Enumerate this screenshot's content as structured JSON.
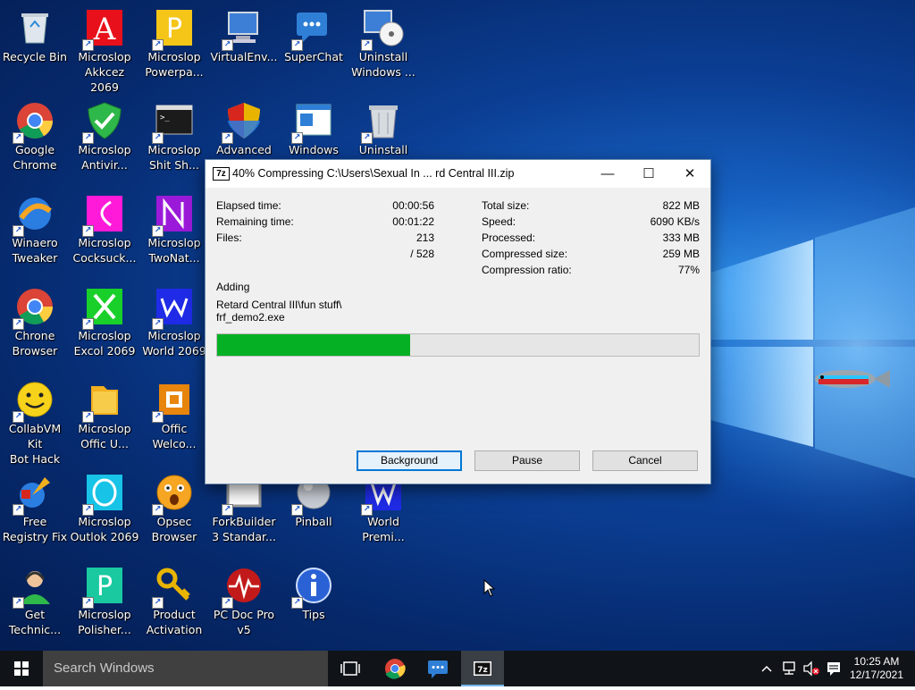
{
  "desktop": {
    "icons": [
      {
        "label": "Recycle Bin",
        "icon": "recycle-bin-icon"
      },
      {
        "label": "Microslop\nAkkcez 2069",
        "icon": "access-app-icon"
      },
      {
        "label": "Microslop\nPowerpa...",
        "icon": "powerpoint-app-icon"
      },
      {
        "label": "VirtualEnv...",
        "icon": "computer-icon"
      },
      {
        "label": "SuperChat",
        "icon": "chat-icon"
      },
      {
        "label": "Uninstall\nWindows ...",
        "icon": "disc-icon"
      },
      {
        "label": "Google\nChrome",
        "icon": "chrome-icon"
      },
      {
        "label": "Microslop\nAntivir...",
        "icon": "shield-check-icon"
      },
      {
        "label": "Microslop\nShit Sh...",
        "icon": "terminal-icon"
      },
      {
        "label": "Advanced",
        "icon": "security-shield-icon"
      },
      {
        "label": "Windows",
        "icon": "window-icon"
      },
      {
        "label": "Uninstall",
        "icon": "trash-can-icon"
      },
      {
        "label": "Winaero\nTweaker",
        "icon": "winaero-icon"
      },
      {
        "label": "Microslop\nCocksuck...",
        "icon": "app-magenta-icon"
      },
      {
        "label": "Microslop\nTwoNat...",
        "icon": "app-purple-icon"
      },
      {
        "label": "Chrone\nBrowser",
        "icon": "chrome-icon"
      },
      {
        "label": "Microslop\nExcol 2069",
        "icon": "excel-app-icon"
      },
      {
        "label": "Microslop\nWorld 2069",
        "icon": "word-app-icon"
      },
      {
        "label": "CollabVM Kit\nBot Hack",
        "icon": "smiley-icon"
      },
      {
        "label": "Microslop\nOffic U...",
        "icon": "office-folder-icon"
      },
      {
        "label": "Offic\nWelco...",
        "icon": "office-logo-icon"
      },
      {
        "label": "Free\nRegistry Fix",
        "icon": "registry-fix-icon"
      },
      {
        "label": "Microslop\nOutlok 2069",
        "icon": "outlook-app-icon"
      },
      {
        "label": "Opsec\nBrowser",
        "icon": "shocked-face-icon"
      },
      {
        "label": "ForkBuilder\n3 Standar...",
        "icon": "forkbuilder-icon"
      },
      {
        "label": "Pinball",
        "icon": "pinball-icon"
      },
      {
        "label": "World\nPremi...",
        "icon": "word-premium-icon"
      },
      {
        "label": "Get\nTechnic...",
        "icon": "support-person-icon"
      },
      {
        "label": "Microslop\nPolisher...",
        "icon": "publisher-app-icon"
      },
      {
        "label": "Product\nActivation",
        "icon": "key-icon"
      },
      {
        "label": "PC Doc Pro\nv5",
        "icon": "pc-doc-icon"
      },
      {
        "label": "Tips",
        "icon": "info-icon"
      }
    ]
  },
  "dialog": {
    "app_icon": "7z",
    "title": "40% Compressing C:\\Users\\Sexual In ... rd Central III.zip",
    "controls": {
      "minimize": "—",
      "maximize": "☐",
      "close": "✕"
    },
    "left_stats": [
      {
        "label": "Elapsed time:",
        "value": "00:00:56"
      },
      {
        "label": "Remaining time:",
        "value": "00:01:22"
      },
      {
        "label": "Files:",
        "value": "213"
      },
      {
        "label": "",
        "value": "/ 528"
      }
    ],
    "right_stats": [
      {
        "label": "Total size:",
        "value": "822 MB"
      },
      {
        "label": "Speed:",
        "value": "6090 KB/s"
      },
      {
        "label": "Processed:",
        "value": "333 MB"
      },
      {
        "label": "Compressed size:",
        "value": "259 MB"
      },
      {
        "label": "Compression ratio:",
        "value": "77%"
      }
    ],
    "action": "Adding",
    "current_file_line1": "Retard Central III\\fun stuff\\",
    "current_file_line2": "frf_demo2.exe",
    "progress": 40,
    "buttons": {
      "background": "Background",
      "pause": "Pause",
      "cancel": "Cancel"
    }
  },
  "taskbar": {
    "search_placeholder": "Search Windows",
    "pinned": [
      "task-view-icon",
      "chrome-icon",
      "chat-icon",
      "7zip-icon"
    ],
    "tray_icons": [
      "chevron-up-icon",
      "network-icon",
      "volume-muted-icon",
      "notifications-icon"
    ],
    "time": "10:25 AM",
    "date": "12/17/2021"
  },
  "colors": {
    "progress_fill": "#06b025",
    "taskbar": "#101418",
    "desktop_blue": "#0b3f95",
    "accent": "#0078d7"
  }
}
